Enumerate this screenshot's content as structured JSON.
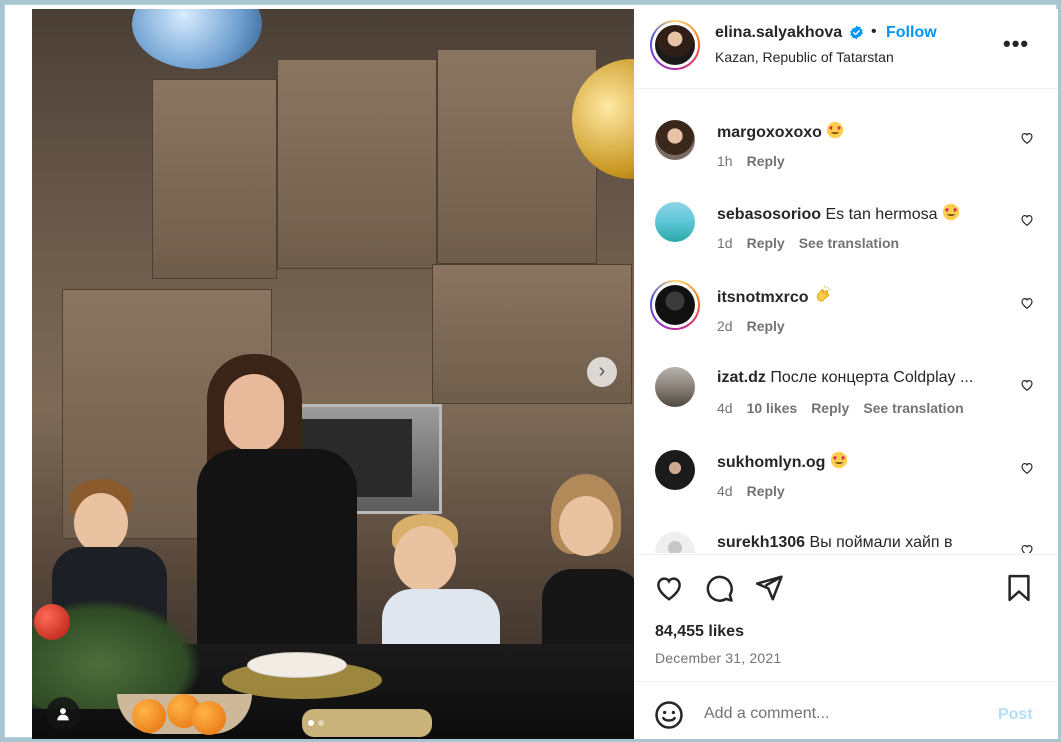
{
  "post": {
    "username": "elina.salyakhova",
    "separator": "•",
    "follow_label": "Follow",
    "location": "Kazan, Republic of Tatarstan",
    "more_icon": "more-horizontal-icon",
    "more_label": "•••",
    "verified": true
  },
  "photo": {
    "carousel_index": 1,
    "carousel_total": 2,
    "next_icon": "chevron-right-icon",
    "next_label": "›",
    "tag_icon": "user-tag-icon"
  },
  "comments": [
    {
      "user": "margoxoxoxo",
      "text": "",
      "emoji": "heart-eyes-emoji",
      "time": "1h",
      "likes": "",
      "reply": "Reply",
      "translate": ""
    },
    {
      "user": "sebasosorioo",
      "text": "Es tan hermosa",
      "emoji": "heart-eyes-emoji",
      "time": "1d",
      "likes": "",
      "reply": "Reply",
      "translate": "See translation"
    },
    {
      "user": "itsnotmxrco",
      "text": "",
      "emoji": "clapping-hands-emoji",
      "time": "2d",
      "likes": "",
      "reply": "Reply",
      "translate": ""
    },
    {
      "user": "izat.dz",
      "text": "После концерта Coldplay ...",
      "emoji": "",
      "time": "4d",
      "likes": "10 likes",
      "reply": "Reply",
      "translate": "See translation"
    },
    {
      "user": "sukhomlyn.og",
      "text": "",
      "emoji": "heart-eyes-emoji",
      "time": "4d",
      "likes": "",
      "reply": "Reply",
      "translate": ""
    },
    {
      "user": "surekh1306",
      "text": "Вы поймали хайп в",
      "emoji": "",
      "time": "",
      "likes": "",
      "reply": "",
      "translate": ""
    }
  ],
  "actions": {
    "like_icon": "heart-icon",
    "comment_icon": "comment-icon",
    "share_icon": "send-icon",
    "save_icon": "bookmark-icon",
    "likes_count": "84,455 likes",
    "date": "December 31, 2021"
  },
  "add_comment": {
    "emoji_icon": "smile-icon",
    "placeholder": "Add a comment...",
    "post_label": "Post"
  },
  "colors": {
    "accent": "#0095f6",
    "post_disabled": "#b2dffc",
    "secondary_text": "#737373",
    "emoji_heart": "#e0245e"
  }
}
